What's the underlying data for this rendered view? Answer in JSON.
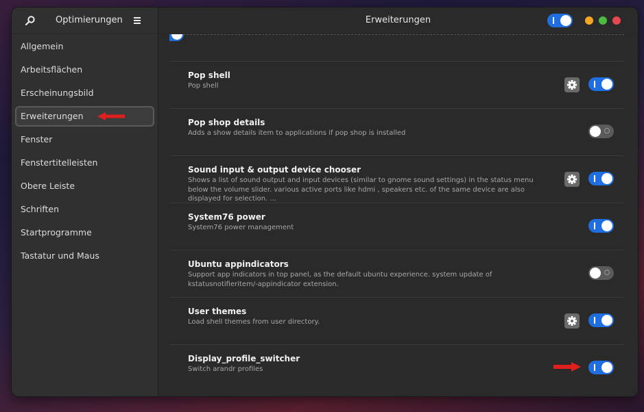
{
  "sidebar": {
    "title": "Optimierungen",
    "items": [
      {
        "label": "Allgemein"
      },
      {
        "label": "Arbeitsflächen"
      },
      {
        "label": "Erscheinungsbild"
      },
      {
        "label": "Erweiterungen"
      },
      {
        "label": "Fenster"
      },
      {
        "label": "Fenstertitelleisten"
      },
      {
        "label": "Obere Leiste"
      },
      {
        "label": "Schriften"
      },
      {
        "label": "Startprogramme"
      },
      {
        "label": "Tastatur und Maus"
      }
    ],
    "active_index": 3
  },
  "header": {
    "title": "Erweiterungen",
    "extensions_enabled": true
  },
  "extensions": [
    {
      "name": "Pop shell",
      "description": "Pop shell",
      "has_settings": true,
      "enabled": true
    },
    {
      "name": "Pop shop details",
      "description": "Adds a show details item to applications if pop shop is installed",
      "has_settings": false,
      "enabled": false
    },
    {
      "name": "Sound input & output device chooser",
      "description": "Shows a list of sound output and input devices (similar to gnome sound settings) in the status menu below the volume slider. various active ports like hdmi , speakers etc. of the same device are also displayed for selection. ...",
      "has_settings": true,
      "enabled": true
    },
    {
      "name": "System76 power",
      "description": "System76 power management",
      "has_settings": false,
      "enabled": true
    },
    {
      "name": "Ubuntu appindicators",
      "description": "Support app indicators in top panel, as the default ubuntu experience. system update of kstatusnotifieritem/-appindicator extension.",
      "has_settings": false,
      "enabled": false
    },
    {
      "name": "User themes",
      "description": "Load shell themes from user directory.",
      "has_settings": true,
      "enabled": true
    },
    {
      "name": "Display_profile_switcher",
      "description": "Switch arandr profiles",
      "has_settings": false,
      "enabled": true
    }
  ],
  "colors": {
    "accent": "#1f6fe0",
    "annotation_arrow": "#e0201c"
  }
}
